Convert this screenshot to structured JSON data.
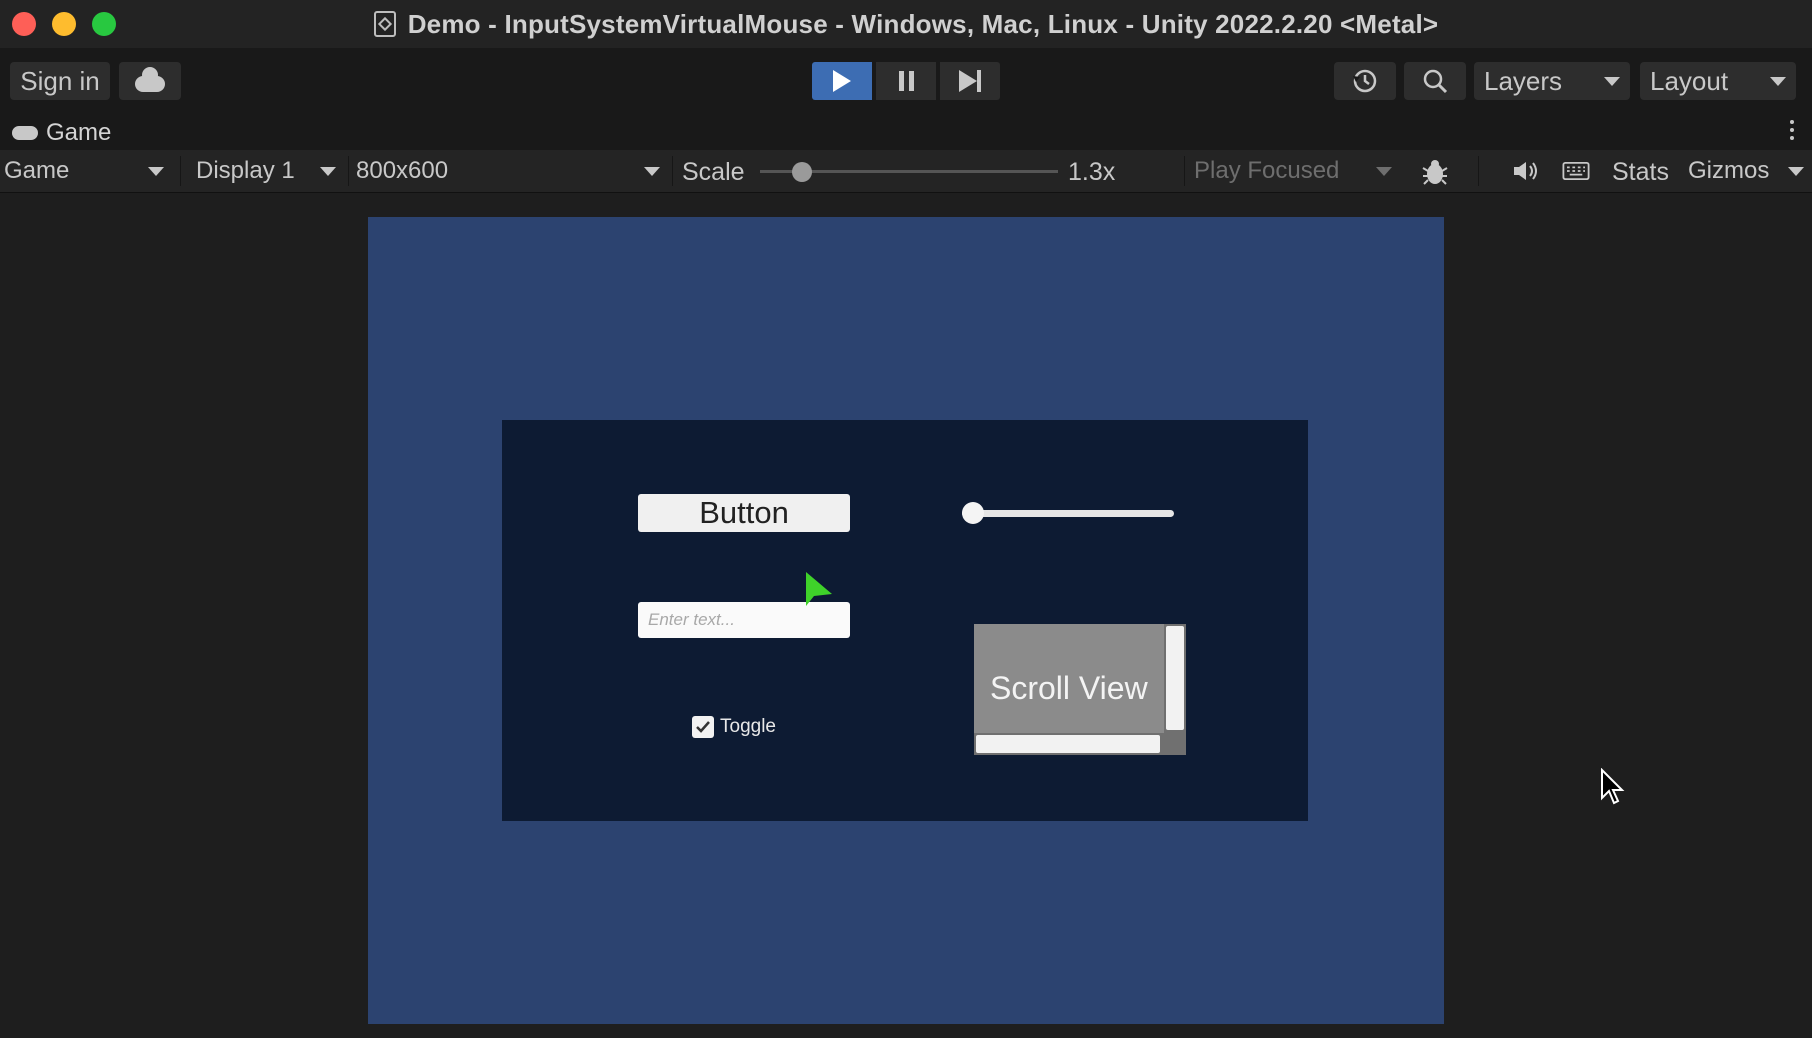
{
  "window": {
    "title": "Demo - InputSystemVirtualMouse - Windows, Mac, Linux - Unity 2022.2.20 <Metal>"
  },
  "toolbar": {
    "sign_in": "Sign in",
    "layers": "Layers",
    "layout": "Layout",
    "play_color": "#3d6db3"
  },
  "panel_tab": {
    "label": "Game",
    "icon": "gamepad-icon"
  },
  "game_controls": {
    "view_mode": "Game",
    "display": "Display 1",
    "resolution": "800x600",
    "scale_label": "Scale",
    "scale_value": "1.3x",
    "scale_fraction": 0.13,
    "play_mode": "Play Focused",
    "stats": "Stats",
    "gizmos": "Gizmos"
  },
  "game_ui": {
    "button_label": "Button",
    "slider_value": 0.0,
    "input_placeholder": "Enter text...",
    "toggle_label": "Toggle",
    "toggle_checked": true,
    "scroll_view_label": "Scroll View",
    "screen_color": "#2c4370",
    "panel_color": "#0d1b33",
    "virtual_cursor_color": "#3fd22a"
  }
}
